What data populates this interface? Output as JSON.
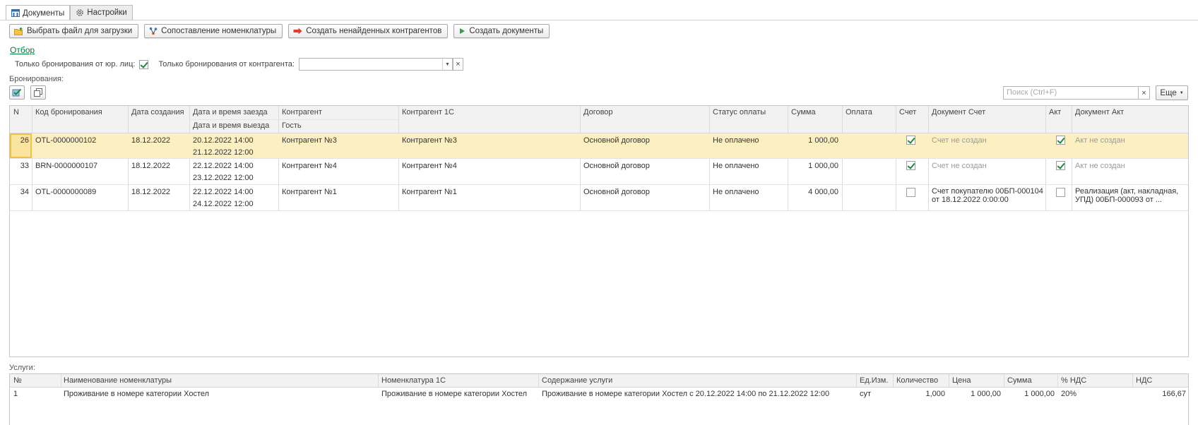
{
  "tabs": [
    {
      "label": "Документы",
      "icon": "documents-icon",
      "active": true
    },
    {
      "label": "Настройки",
      "icon": "gear-icon",
      "active": false
    }
  ],
  "toolbar": {
    "select_file": "Выбрать файл для загрузки",
    "mapping": "Сопоставление номенклатуры",
    "create_contractors": "Создать ненайденных контрагентов",
    "create_documents": "Создать документы"
  },
  "filter": {
    "link": "Отбор",
    "only_legal_label": "Только бронирования от юр. лиц:",
    "only_legal_checked": true,
    "only_contractor_label": "Только бронирования от контрагента:",
    "contractor_value": ""
  },
  "bookings": {
    "label": "Бронирования:",
    "search_placeholder": "Поиск (Ctrl+F)",
    "more_label": "Еще",
    "headers": {
      "n": "N",
      "code": "Код бронирования",
      "created": "Дата создания",
      "checkin": "Дата и время заезда",
      "checkout": "Дата и время выезда",
      "contractor": "Контрагент",
      "guest": "Гость",
      "contractor_1c": "Контрагент 1С",
      "contract": "Договор",
      "pay_status": "Статус оплаты",
      "sum": "Сумма",
      "payment": "Оплата",
      "invoice": "Счет",
      "invoice_doc": "Документ Счет",
      "act": "Акт",
      "act_doc": "Документ Акт"
    },
    "rows": [
      {
        "n": "26",
        "code": "OTL-0000000102",
        "created": "18.12.2022",
        "checkin": "20.12.2022 14:00",
        "checkout": "21.12.2022 12:00",
        "contractor": "Контрагент №3",
        "guest": "",
        "contractor_1c": "Контрагент №3",
        "contract": "Основной договор",
        "pay_status": "Не оплачено",
        "sum": "1 000,00",
        "payment": "",
        "invoice": true,
        "invoice_doc": "Счет не создан",
        "invoice_doc_line2": "",
        "act": true,
        "act_doc": "Акт не создан",
        "act_doc_line2": ""
      },
      {
        "n": "33",
        "code": "BRN-0000000107",
        "created": "18.12.2022",
        "checkin": "22.12.2022 14:00",
        "checkout": "23.12.2022 12:00",
        "contractor": "Контрагент №4",
        "guest": "",
        "contractor_1c": "Контрагент №4",
        "contract": "Основной договор",
        "pay_status": "Не оплачено",
        "sum": "1 000,00",
        "payment": "",
        "invoice": true,
        "invoice_doc": "Счет не создан",
        "invoice_doc_line2": "",
        "act": true,
        "act_doc": "Акт не создан",
        "act_doc_line2": ""
      },
      {
        "n": "34",
        "code": "OTL-0000000089",
        "created": "18.12.2022",
        "checkin": "22.12.2022 14:00",
        "checkout": "24.12.2022 12:00",
        "contractor": "Контрагент №1",
        "guest": "",
        "contractor_1c": "Контрагент №1",
        "contract": "Основной договор",
        "pay_status": "Не оплачено",
        "sum": "4 000,00",
        "payment": "",
        "invoice": false,
        "invoice_doc": "Счет покупателю 00БП-000104",
        "invoice_doc_line2": "от 18.12.2022 0:00:00",
        "act": false,
        "act_doc": "Реализация (акт, накладная,",
        "act_doc_line2": "УПД) 00БП-000093 от ..."
      }
    ]
  },
  "services": {
    "label": "Услуги:",
    "headers": {
      "n": "№",
      "name": "Наименование номенклатуры",
      "nom_1c": "Номенклатура 1С",
      "content": "Содержание услуги",
      "unit": "Ед.Изм.",
      "qty": "Количество",
      "price": "Цена",
      "sum": "Сумма",
      "vat_pct": "% НДС",
      "vat": "НДС"
    },
    "rows": [
      {
        "n": "1",
        "name": "Проживание в номере категории Хостел",
        "nom_1c": "Проживание в номере категории Хостел",
        "content": "Проживание в номере категории Хостел с 20.12.2022 14:00 по 21.12.2022 12:00",
        "unit": "сут",
        "qty": "1,000",
        "price": "1 000,00",
        "sum": "1 000,00",
        "vat_pct": "20%",
        "vat": "166,67"
      }
    ]
  },
  "colors": {
    "accent_green": "#1d8a3b",
    "selected_row": "#fcf0c2",
    "link": "#007a3d"
  }
}
